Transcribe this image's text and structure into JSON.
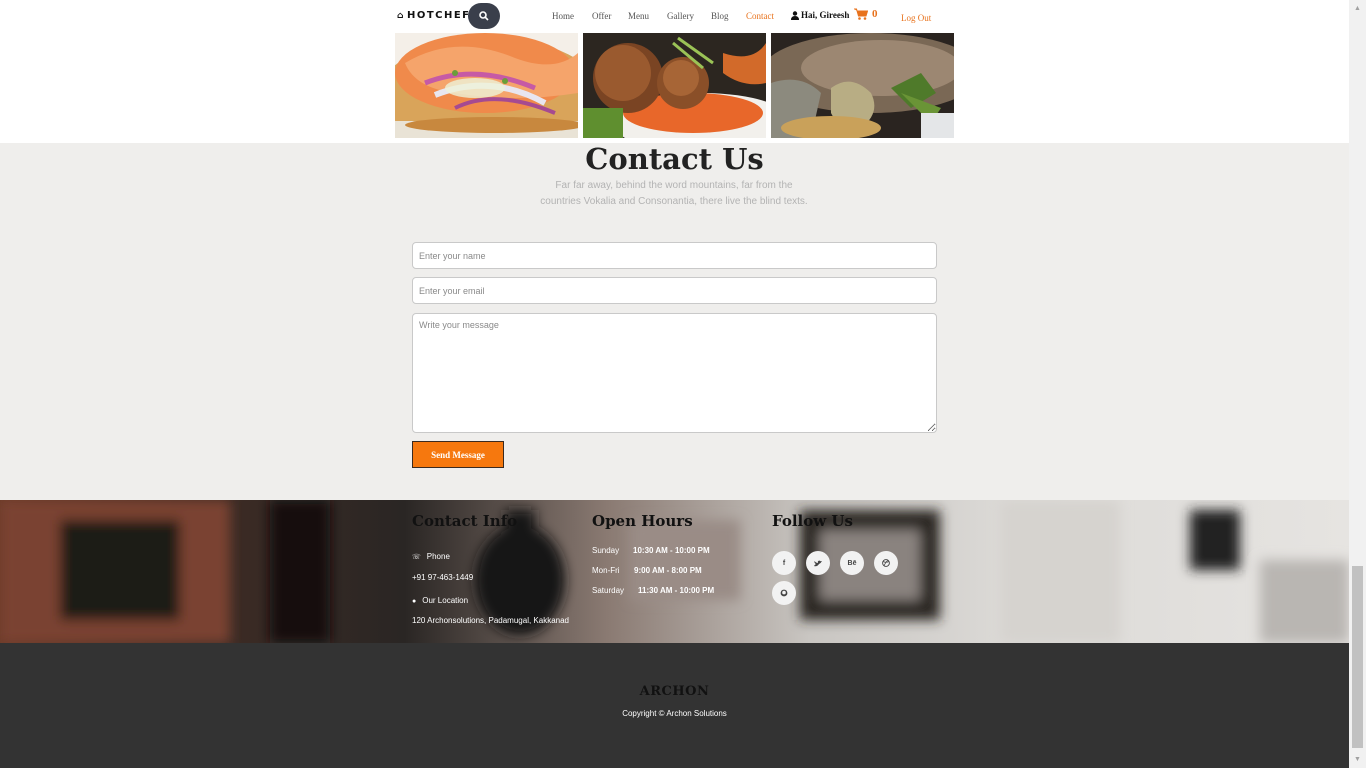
{
  "nav": {
    "brand": "HOTCHEF",
    "links": [
      "Home",
      "Offer",
      "Menu",
      "Gallery",
      "Blog",
      "Contact"
    ],
    "active": "Contact",
    "user": "Hai, Gireesh",
    "cart_count": "0",
    "logout": "Log Out",
    "accent_color": "#e8721c"
  },
  "contact": {
    "title": "Contact Us",
    "subtitle_line1": "Far far away, behind the word mountains, far from the",
    "subtitle_line2": "countries Vokalia and Consonantia, there live the blind texts.",
    "name_placeholder": "Enter your name",
    "email_placeholder": "Enter your email",
    "message_placeholder": "Write your message",
    "send_label": "Send Message",
    "button_color": "#f6780e"
  },
  "info": {
    "contact_title": "Contact Info",
    "phone_label": "Phone",
    "phone_value": "+91 97-463-1449",
    "location_label": "Our Location",
    "location_value": "120 Archonsolutions, Padamugal, Kakkanad",
    "hours_title": "Open Hours",
    "hours": [
      {
        "day": "Sunday",
        "time": "10:30 AM - 10:00 PM"
      },
      {
        "day": "Mon-Fri",
        "time": "9:00 AM - 8:00 PM"
      },
      {
        "day": "Saturday",
        "time": "11:30 AM - 10:00 PM"
      }
    ],
    "follow_title": "Follow Us",
    "social": [
      "facebook-icon",
      "twitter-icon",
      "behance-icon",
      "dribbble-icon",
      "github-icon"
    ]
  },
  "footer": {
    "brand": "ARCHON",
    "copyright": "Copyright © Archon Solutions"
  }
}
